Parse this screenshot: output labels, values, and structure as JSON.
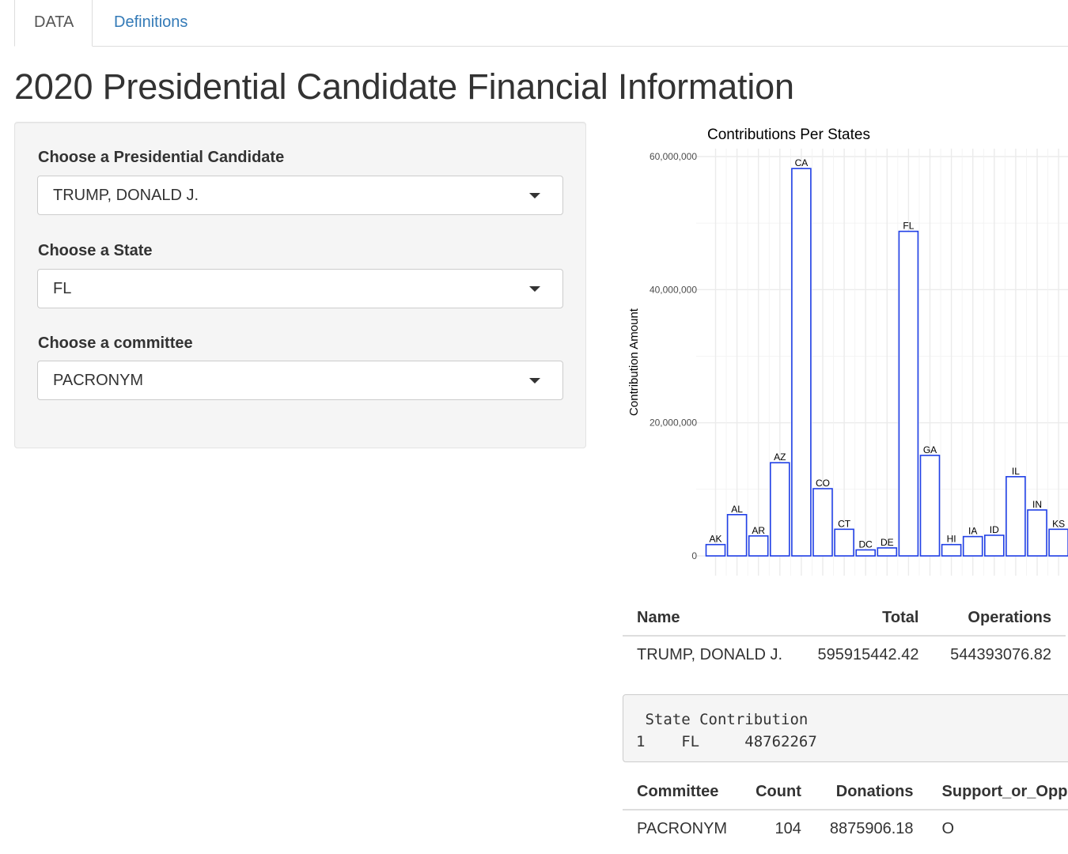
{
  "tabs": [
    {
      "label": "DATA",
      "active": true
    },
    {
      "label": "Definitions",
      "active": false
    }
  ],
  "page_title": "2020 Presidential Candidate Financial Information",
  "sidebar": {
    "candidate_label": "Choose a Presidential Candidate",
    "candidate_value": "TRUMP, DONALD J.",
    "state_label": "Choose a State",
    "state_value": "FL",
    "committee_label": "Choose a committee",
    "committee_value": "PACRONYM"
  },
  "chart_data": {
    "type": "bar",
    "title": "Contributions Per States",
    "ylabel": "Contribution Amount",
    "xlabel": "",
    "ylim": [
      0,
      60000000
    ],
    "y_ticks": [
      0,
      20000000,
      40000000,
      60000000
    ],
    "y_tick_labels": [
      "0",
      "20,000,000",
      "40,000,000",
      "60,000,000"
    ],
    "categories": [
      "AK",
      "AL",
      "AR",
      "AZ",
      "CA",
      "CO",
      "CT",
      "DC",
      "DE",
      "FL",
      "GA",
      "HI",
      "IA",
      "ID",
      "IL",
      "IN",
      "KS"
    ],
    "values": [
      1700000,
      6200000,
      3000000,
      14000000,
      58200000,
      10100000,
      4000000,
      900000,
      1200000,
      48762267,
      15100000,
      1700000,
      2900000,
      3100000,
      11900000,
      6900000,
      4000000
    ],
    "bar_fill": "#ffffff",
    "bar_stroke": "#1f3fe6",
    "grid": true
  },
  "summary_table": {
    "headers": [
      "Name",
      "Total",
      "Operations"
    ],
    "rows": [
      [
        "TRUMP, DONALD J.",
        "595915442.42",
        "544393076.82"
      ]
    ]
  },
  "state_output": {
    "line1": " State Contribution",
    "line2": "1    FL     48762267"
  },
  "committee_table": {
    "headers": [
      "Committee",
      "Count",
      "Donations",
      "Support_or_Oppose"
    ],
    "rows": [
      [
        "PACRONYM",
        "104",
        "8875906.18",
        "O"
      ]
    ]
  }
}
